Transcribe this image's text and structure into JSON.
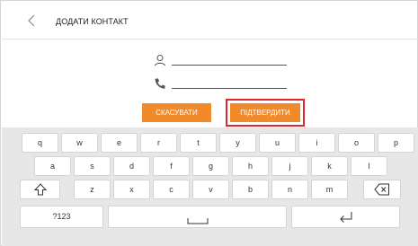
{
  "header": {
    "title": "ДОДАТИ КОНТАКТ"
  },
  "buttons": {
    "cancel": "СКАСУВАТИ",
    "confirm": "ПІДТВЕРДИТИ"
  },
  "keyboard": {
    "row1": [
      "q",
      "w",
      "e",
      "r",
      "t",
      "y",
      "u",
      "i",
      "o",
      "p"
    ],
    "row2": [
      "a",
      "s",
      "d",
      "f",
      "g",
      "h",
      "j",
      "k",
      "l"
    ],
    "row3": [
      "z",
      "x",
      "c",
      "v",
      "b",
      "n",
      "m"
    ],
    "numbers_key": "?123"
  },
  "icons": {
    "back": "chevron-left-icon",
    "name": "person-icon",
    "phone": "phone-icon",
    "shift": "shift-arrow-icon",
    "backspace": "backspace-icon",
    "space": "space-bar-icon",
    "enter": "enter-return-icon"
  },
  "colors": {
    "accent": "#f08a2a",
    "highlight": "#e0262c",
    "keyboard_bg": "#e7e7e7"
  }
}
